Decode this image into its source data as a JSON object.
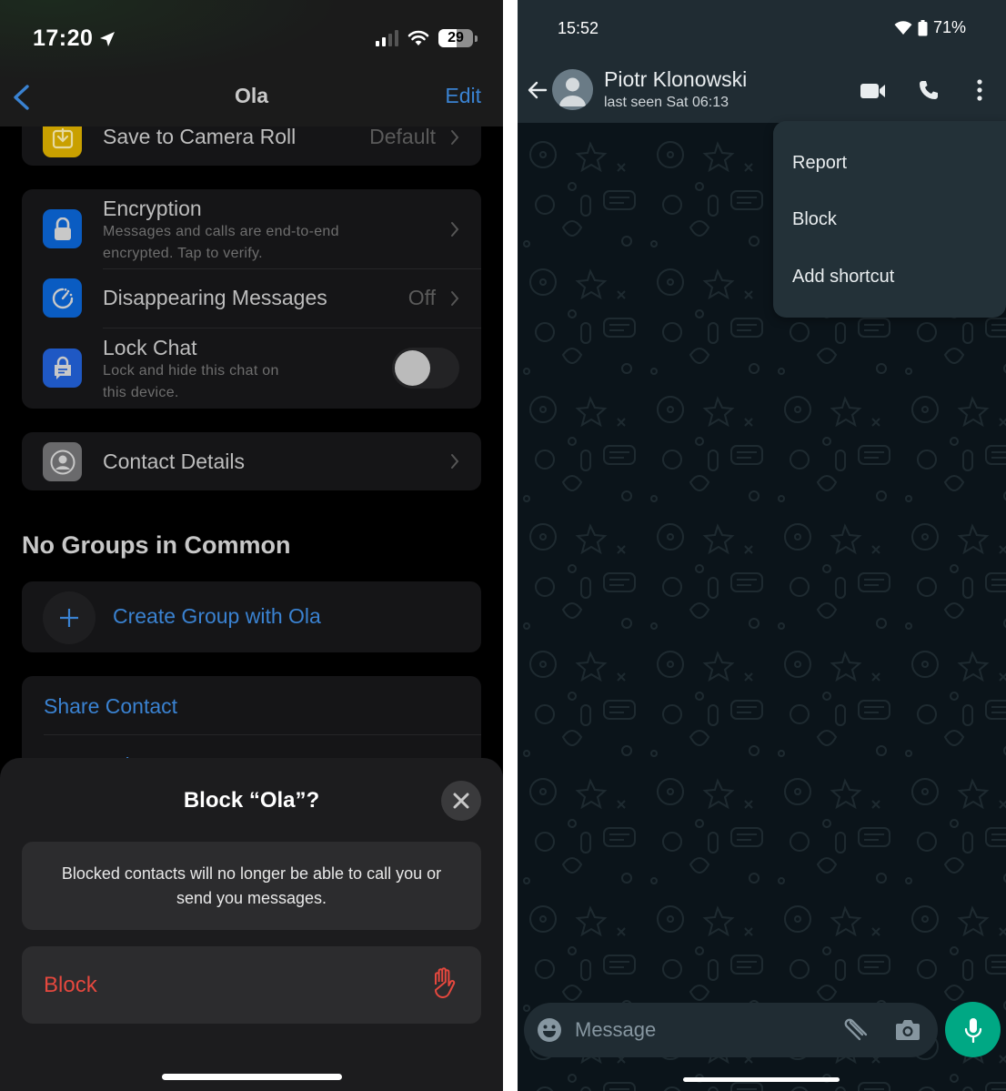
{
  "ios": {
    "status": {
      "time": "17:20",
      "battery": "29",
      "battery_level": 0.29
    },
    "nav": {
      "title": "Ola",
      "edit_label": "Edit"
    },
    "media_row": {
      "label": "Save to Camera Roll",
      "value": "Default"
    },
    "security_rows": [
      {
        "label": "Encryption",
        "sub_line1": "Messages and calls are end-to-end",
        "sub_line2": "encrypted. Tap to verify."
      },
      {
        "label": "Disappearing Messages",
        "value": "Off"
      },
      {
        "label": "Lock Chat",
        "sub_line1": "Lock and hide this chat on",
        "sub_line2": "this device.",
        "toggle_on": false
      }
    ],
    "contact_details": {
      "label": "Contact Details"
    },
    "groups": {
      "section_title": "No Groups in Common",
      "create_label": "Create Group with Ola"
    },
    "actions": {
      "share_contact": "Share Contact",
      "export_chat": "Export Chat"
    },
    "sheet": {
      "title": "Block “Ola”?",
      "message": "Blocked contacts will no longer be able to call you or send you messages.",
      "block_label": "Block"
    },
    "colors": {
      "accent_blue": "#3a82d1",
      "destructive_red": "#e5483e",
      "camera_roll_icon": "#c9a000",
      "security_icon": "#0a5cc2"
    }
  },
  "android": {
    "status": {
      "time": "15:52",
      "battery": "71%"
    },
    "header": {
      "name": "Piotr Klonowski",
      "last_seen": "last seen Sat 06:13"
    },
    "menu": {
      "items": [
        "Report",
        "Block",
        "Add shortcut"
      ]
    },
    "composer": {
      "placeholder": "Message"
    },
    "colors": {
      "header": "#202c33",
      "chat_bg": "#0b141a",
      "mic_button": "#00a884",
      "menu_bg": "#233138"
    }
  }
}
